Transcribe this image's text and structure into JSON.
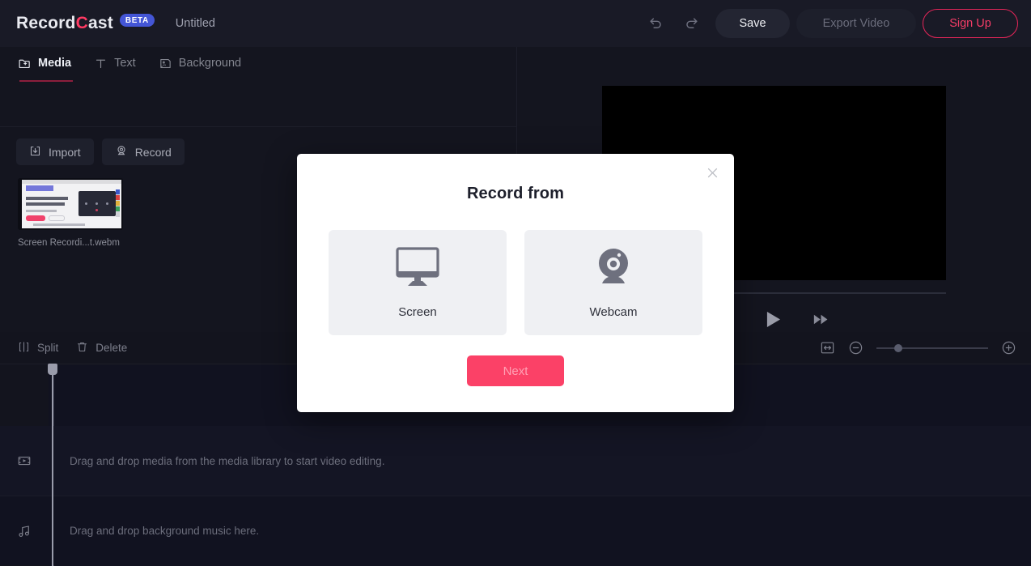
{
  "app": {
    "brand_prefix": "Record",
    "brand_c": "C",
    "brand_suffix": "ast",
    "beta_badge": "BETA",
    "document_title": "Untitled",
    "accent_pink": "#ff3a63",
    "accent_blue": "#4456d6"
  },
  "topbar": {
    "undo_icon": "undo-icon",
    "redo_icon": "redo-icon",
    "save_label": "Save",
    "export_label": "Export Video",
    "signup_label": "Sign Up"
  },
  "sidebar": {
    "tabs": [
      {
        "label": "Media",
        "icon": "folder-add-icon",
        "active": true
      },
      {
        "label": "Text",
        "icon": "text-t-icon",
        "active": false
      },
      {
        "label": "Background",
        "icon": "background-image-icon",
        "active": false
      }
    ],
    "actions": [
      {
        "label": "Import",
        "icon": "import-download-icon"
      },
      {
        "label": "Record",
        "icon": "webcam-record-icon"
      }
    ],
    "media_items": [
      {
        "name": "Screen Recordi...t.webm"
      }
    ]
  },
  "preview": {
    "video_background": "#000000",
    "controls": [
      {
        "name": "rewind-button",
        "icon": "rewind-icon"
      },
      {
        "name": "play-button",
        "icon": "play-icon"
      },
      {
        "name": "fast-forward-button",
        "icon": "fast-forward-icon"
      }
    ]
  },
  "timeline_toolbar": {
    "split_label": "Split",
    "delete_label": "Delete",
    "fit_icon": "fit-to-width-icon",
    "zoom_out_icon": "zoom-out-icon",
    "zoom_in_icon": "zoom-in-icon",
    "zoom_value": 16
  },
  "timeline": {
    "tracks": [
      {
        "icon": "video-track-icon",
        "hint": "Drag and drop media from the media library to start video editing."
      },
      {
        "icon": "music-note-icon",
        "hint": "Drag and drop background music here."
      }
    ]
  },
  "modal": {
    "title": "Record from",
    "close_icon": "close-icon",
    "options": [
      {
        "label": "Screen",
        "icon": "monitor-screen-icon"
      },
      {
        "label": "Webcam",
        "icon": "webcam-icon"
      }
    ],
    "next_label": "Next",
    "next_color": "#fb4167",
    "next_disabled": true
  }
}
